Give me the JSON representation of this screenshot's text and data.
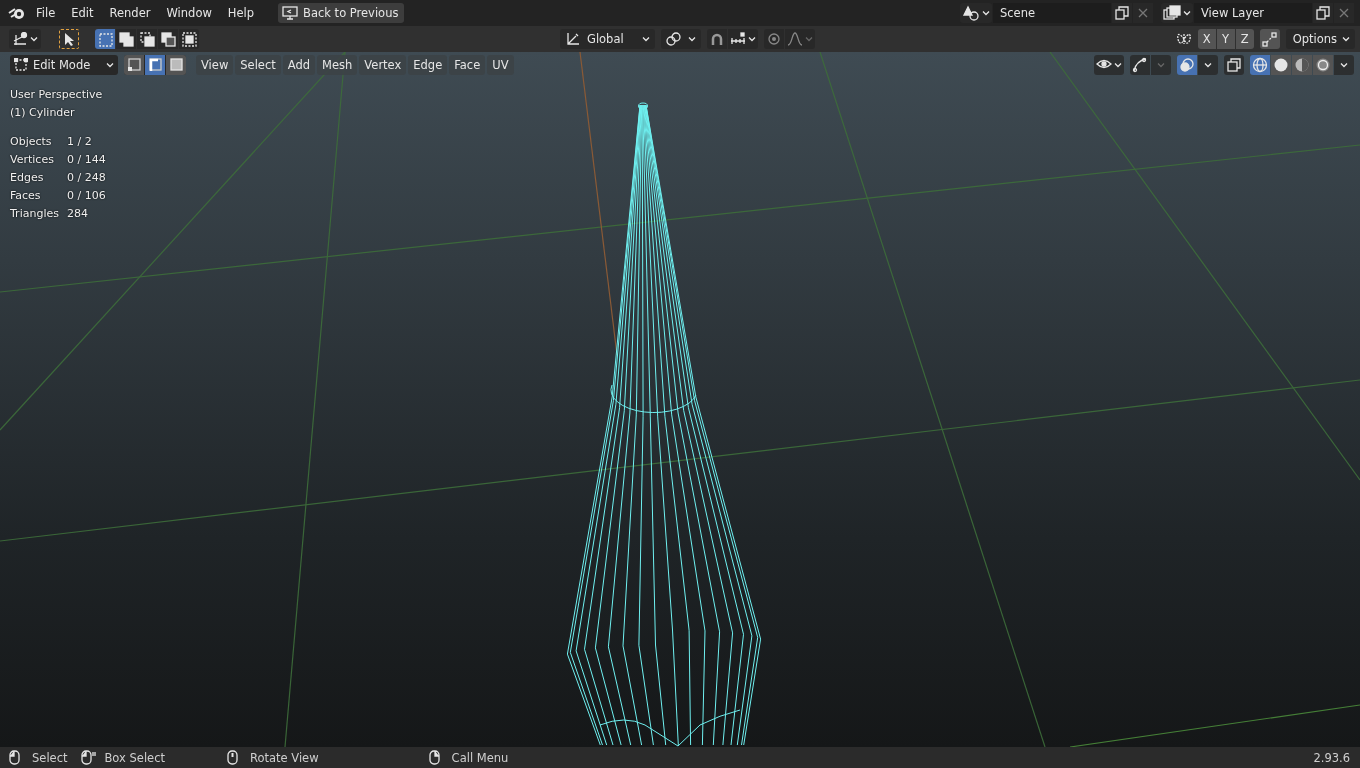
{
  "menu": [
    "File",
    "Edit",
    "Render",
    "Window",
    "Help"
  ],
  "back_button": "Back to Previous",
  "scene": {
    "value": "Scene"
  },
  "view_layer": {
    "value": "View Layer"
  },
  "tool_header": {
    "select_modes": [
      {
        "selected": true
      },
      {
        "selected": false
      },
      {
        "selected": false
      },
      {
        "selected": false
      },
      {
        "selected": false
      }
    ],
    "orientation": "Global",
    "axes": [
      "X",
      "Y",
      "Z"
    ],
    "options": "Options"
  },
  "viewport_header": {
    "mode": "Edit Mode",
    "element_modes": [
      {
        "selected": false
      },
      {
        "selected": true
      },
      {
        "selected": false
      }
    ],
    "menus": [
      "View",
      "Select",
      "Add",
      "Mesh",
      "Vertex",
      "Edge",
      "Face",
      "UV"
    ],
    "overlays_on": true,
    "shading": [
      {
        "selected": true
      },
      {
        "selected": false
      },
      {
        "selected": false
      },
      {
        "selected": false
      }
    ]
  },
  "overlay_text": {
    "view": "User Perspective",
    "object": "(1) Cylinder",
    "stats": [
      {
        "label": "Objects",
        "value": "1 / 2"
      },
      {
        "label": "Vertices",
        "value": "0 / 144"
      },
      {
        "label": "Edges",
        "value": "0 / 248"
      },
      {
        "label": "Faces",
        "value": "0 / 106"
      },
      {
        "label": "Triangles",
        "value": "284"
      }
    ]
  },
  "status_bar": {
    "items": [
      {
        "label": "Select"
      },
      {
        "label": "Box Select"
      },
      {
        "label": "Rotate View"
      },
      {
        "label": "Call Menu"
      }
    ],
    "version": "2.93.6"
  }
}
